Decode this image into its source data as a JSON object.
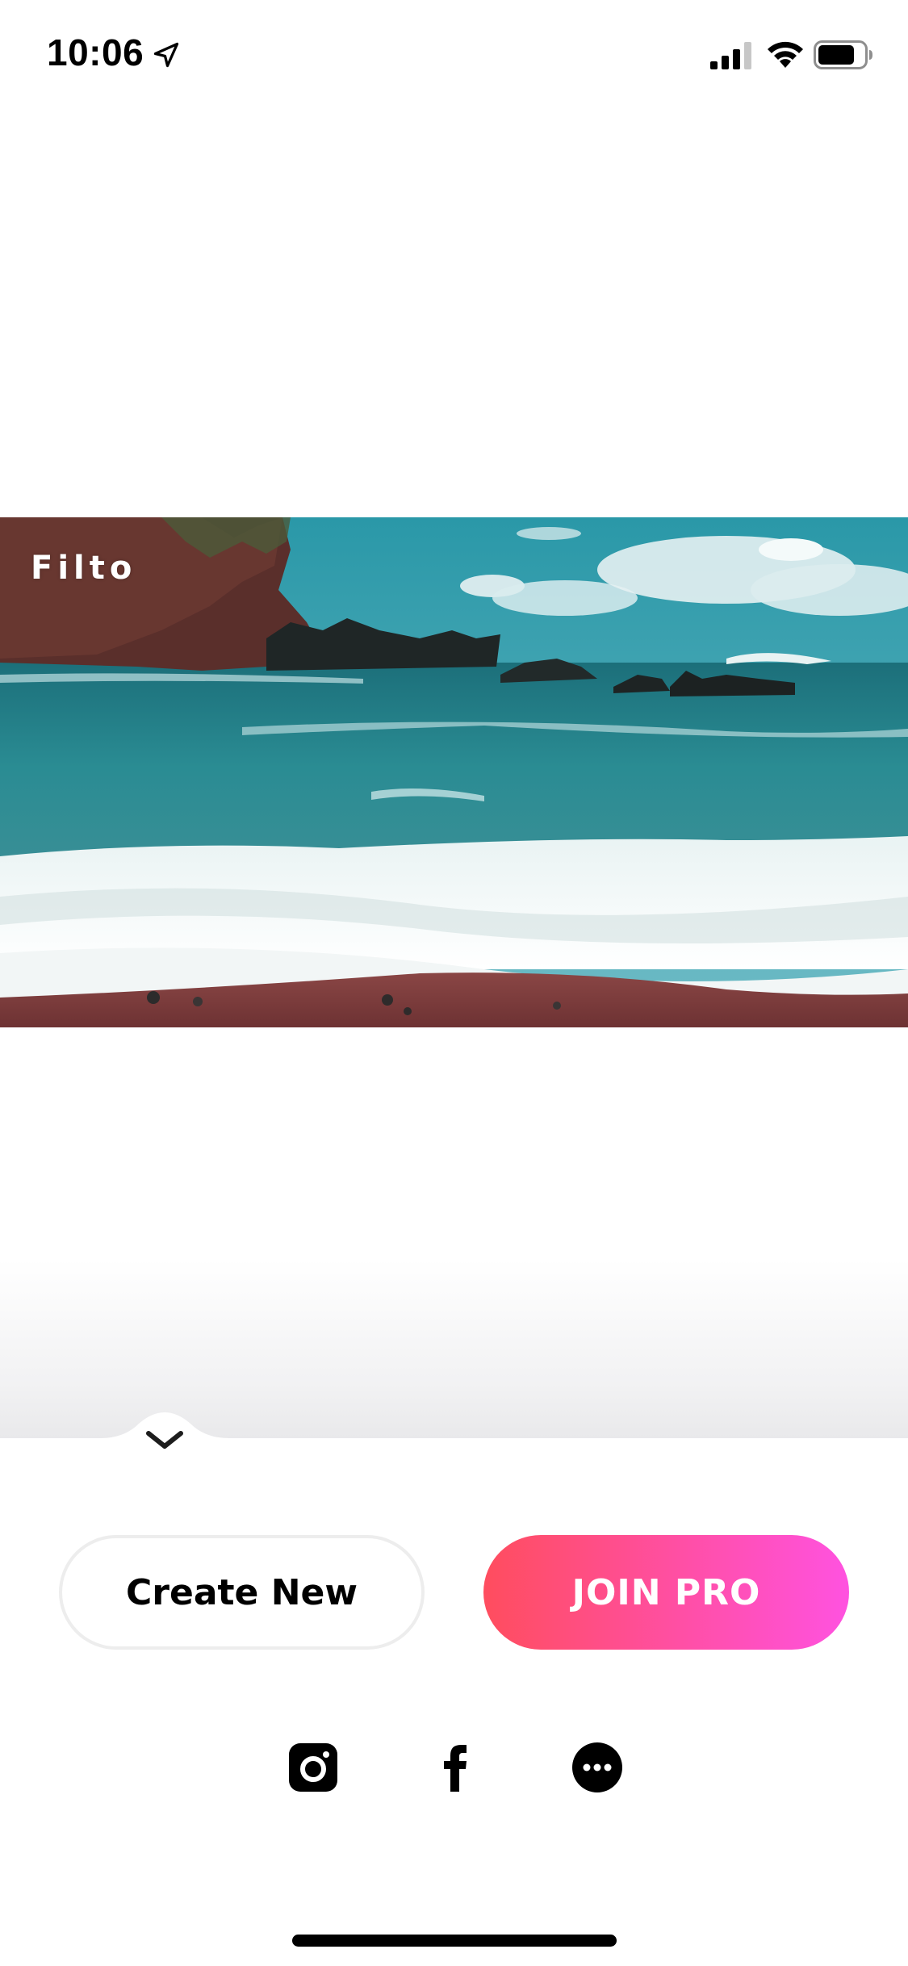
{
  "status_bar": {
    "time": "10:06",
    "location_icon": "location-arrow-icon",
    "signal_icon": "cellular-signal-icon",
    "wifi_icon": "wifi-icon",
    "battery_icon": "battery-icon"
  },
  "preview": {
    "watermark": "Filto",
    "image_description_icon": "beach-waves-photo"
  },
  "sheet": {
    "collapse_icon": "chevron-down-icon"
  },
  "actions": {
    "create_new_label": "Create New",
    "join_pro_label": "JOIN PRO"
  },
  "share": {
    "items": [
      {
        "icon": "instagram-icon"
      },
      {
        "icon": "facebook-icon"
      },
      {
        "icon": "more-icon"
      }
    ]
  },
  "colors": {
    "pro_gradient_start": "#ff4d5e",
    "pro_gradient_end": "#ff52e0",
    "ocean": "#1f7f86",
    "sand": "#7a3b3b"
  }
}
